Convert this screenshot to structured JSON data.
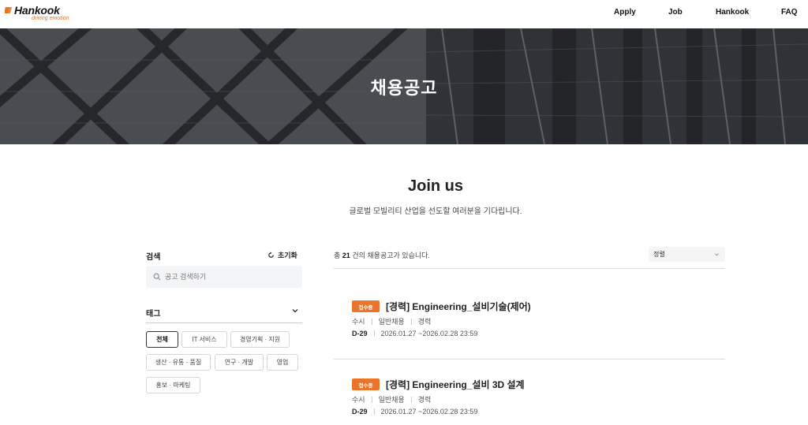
{
  "header": {
    "logo_text": "Hankook",
    "logo_tagline": "driving emotion",
    "nav": [
      {
        "label": "Apply"
      },
      {
        "label": "Job"
      },
      {
        "label": "Hankook"
      },
      {
        "label": "FAQ"
      }
    ]
  },
  "hero": {
    "title": "채용공고"
  },
  "intro": {
    "title": "Join us",
    "subtitle": "글로벌 모빌리티 산업을 선도할 여러분을 기다립니다."
  },
  "sidebar": {
    "search_label": "검색",
    "reset_label": "초기화",
    "search_placeholder": "공고 검색하기",
    "tag_label": "태그",
    "tags": [
      "전체",
      "IT 서비스",
      "경영기획 · 지원",
      "생산 · 유통 · 품질",
      "연구 · 개발",
      "영업",
      "홍보 · 마케팅"
    ],
    "active_tag": "전체"
  },
  "main": {
    "count_prefix": "총",
    "count": "21",
    "count_suffix": "건의 채용공고가 있습니다.",
    "sort_label": "정렬",
    "jobs": [
      {
        "badge": "접수중",
        "title": "[경력] Engineering_설비기술(제어)",
        "type": "수시",
        "category": "일반채용",
        "career": "경력",
        "dday": "D-29",
        "period": "2026.01.27 ~2026.02.28 23:59"
      },
      {
        "badge": "접수중",
        "title": "[경력] Engineering_설비 3D 설계",
        "type": "수시",
        "category": "일반채용",
        "career": "경력",
        "dday": "D-29",
        "period": "2026.01.27 ~2026.02.28 23:59"
      }
    ]
  },
  "colors": {
    "accent": "#e9742b",
    "hero_bg": "#3c3f45",
    "field_bg": "#f4f5f7"
  }
}
